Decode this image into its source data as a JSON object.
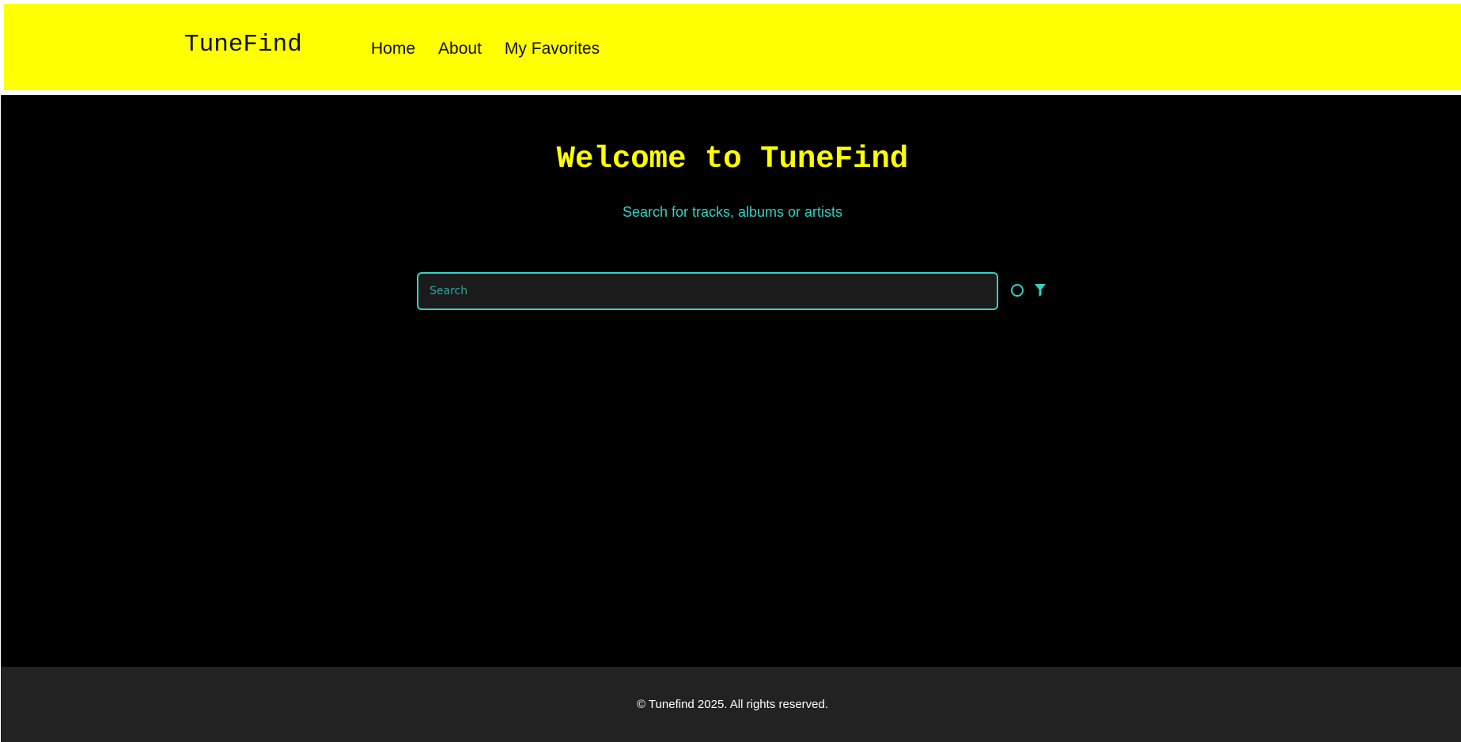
{
  "header": {
    "logo": "TuneFind",
    "nav": [
      {
        "label": "Home"
      },
      {
        "label": "About"
      },
      {
        "label": "My Favorites"
      }
    ]
  },
  "main": {
    "title": "Welcome to TuneFind",
    "subtitle": "Search for tracks, albums or artists",
    "search": {
      "placeholder": "Search",
      "value": ""
    },
    "icons": {
      "status": "loading-spinner-icon",
      "filter": "filter-icon"
    }
  },
  "footer": {
    "text": "© Tunefind 2025. All rights reserved."
  },
  "colors": {
    "header_bg": "#ffff00",
    "page_bg": "#000000",
    "accent": "#2ed3c4",
    "title": "#ffff00",
    "footer_bg": "#222222"
  }
}
